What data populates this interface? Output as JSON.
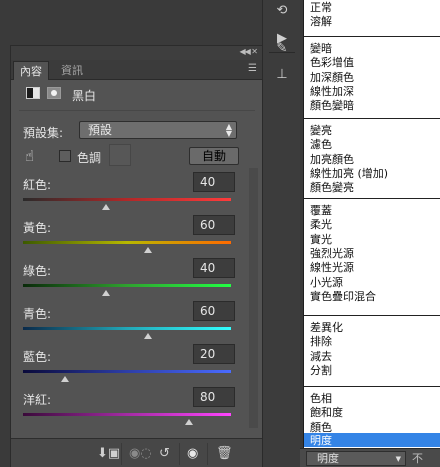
{
  "panel": {
    "tabs": [
      {
        "label": "內容"
      },
      {
        "label": "資訊"
      }
    ],
    "title": "黑白",
    "preset_label": "預設集:",
    "preset_value": "預設",
    "tint_label": "色調",
    "auto_label": "自動",
    "sliders": [
      {
        "label": "紅色:",
        "value": "40",
        "fraction": 0.4,
        "gradient": [
          "#2a2a2a",
          "#b12828",
          "#ff3b3b"
        ]
      },
      {
        "label": "黃色:",
        "value": "60",
        "fraction": 0.6,
        "gradient": [
          "#3c5a00",
          "#b7b800",
          "#ff6a00"
        ]
      },
      {
        "label": "綠色:",
        "value": "40",
        "fraction": 0.4,
        "gradient": [
          "#0a2a0a",
          "#2fa12f",
          "#22ff44"
        ]
      },
      {
        "label": "青色:",
        "value": "60",
        "fraction": 0.6,
        "gradient": [
          "#0a2a4a",
          "#22a7b7",
          "#33ffff"
        ]
      },
      {
        "label": "藍色:",
        "value": "20",
        "fraction": 0.2,
        "gradient": [
          "#0a0a3a",
          "#2d3ea7",
          "#4a6bff"
        ]
      },
      {
        "label": "洋紅:",
        "value": "80",
        "fraction": 0.8,
        "gradient": [
          "#3a0a3a",
          "#a42ca4",
          "#ff44ff"
        ]
      }
    ]
  },
  "blend_modes": {
    "groups": [
      [
        "正常",
        "溶解"
      ],
      [
        "變暗",
        "色彩增值",
        "加深顏色",
        "線性加深",
        "顏色變暗"
      ],
      [
        "變亮",
        "濾色",
        "加亮顏色",
        "線性加亮 (增加)",
        "顏色變亮"
      ],
      [
        "覆蓋",
        "柔光",
        "實光",
        "強烈光源",
        "線性光源",
        "小光源",
        "實色疊印混合"
      ],
      [
        "差異化",
        "排除",
        "減去",
        "分割"
      ],
      [
        "色相",
        "飽和度",
        "顏色"
      ]
    ],
    "selected": "明度",
    "field_value": "明度",
    "next_label": "不"
  },
  "colors": {
    "accent": "#3484e6",
    "panel_bg": "#535353"
  },
  "icons": {
    "history": "history-icon",
    "play": "play-icon",
    "brush": "brush-icon",
    "stamp": "stamp-icon",
    "target_adjust": "hand-target-icon",
    "clip": "clip-to-layer-icon",
    "view_previous": "view-previous-icon",
    "reset": "reset-icon",
    "visibility": "eye-icon",
    "delete": "trash-icon"
  }
}
